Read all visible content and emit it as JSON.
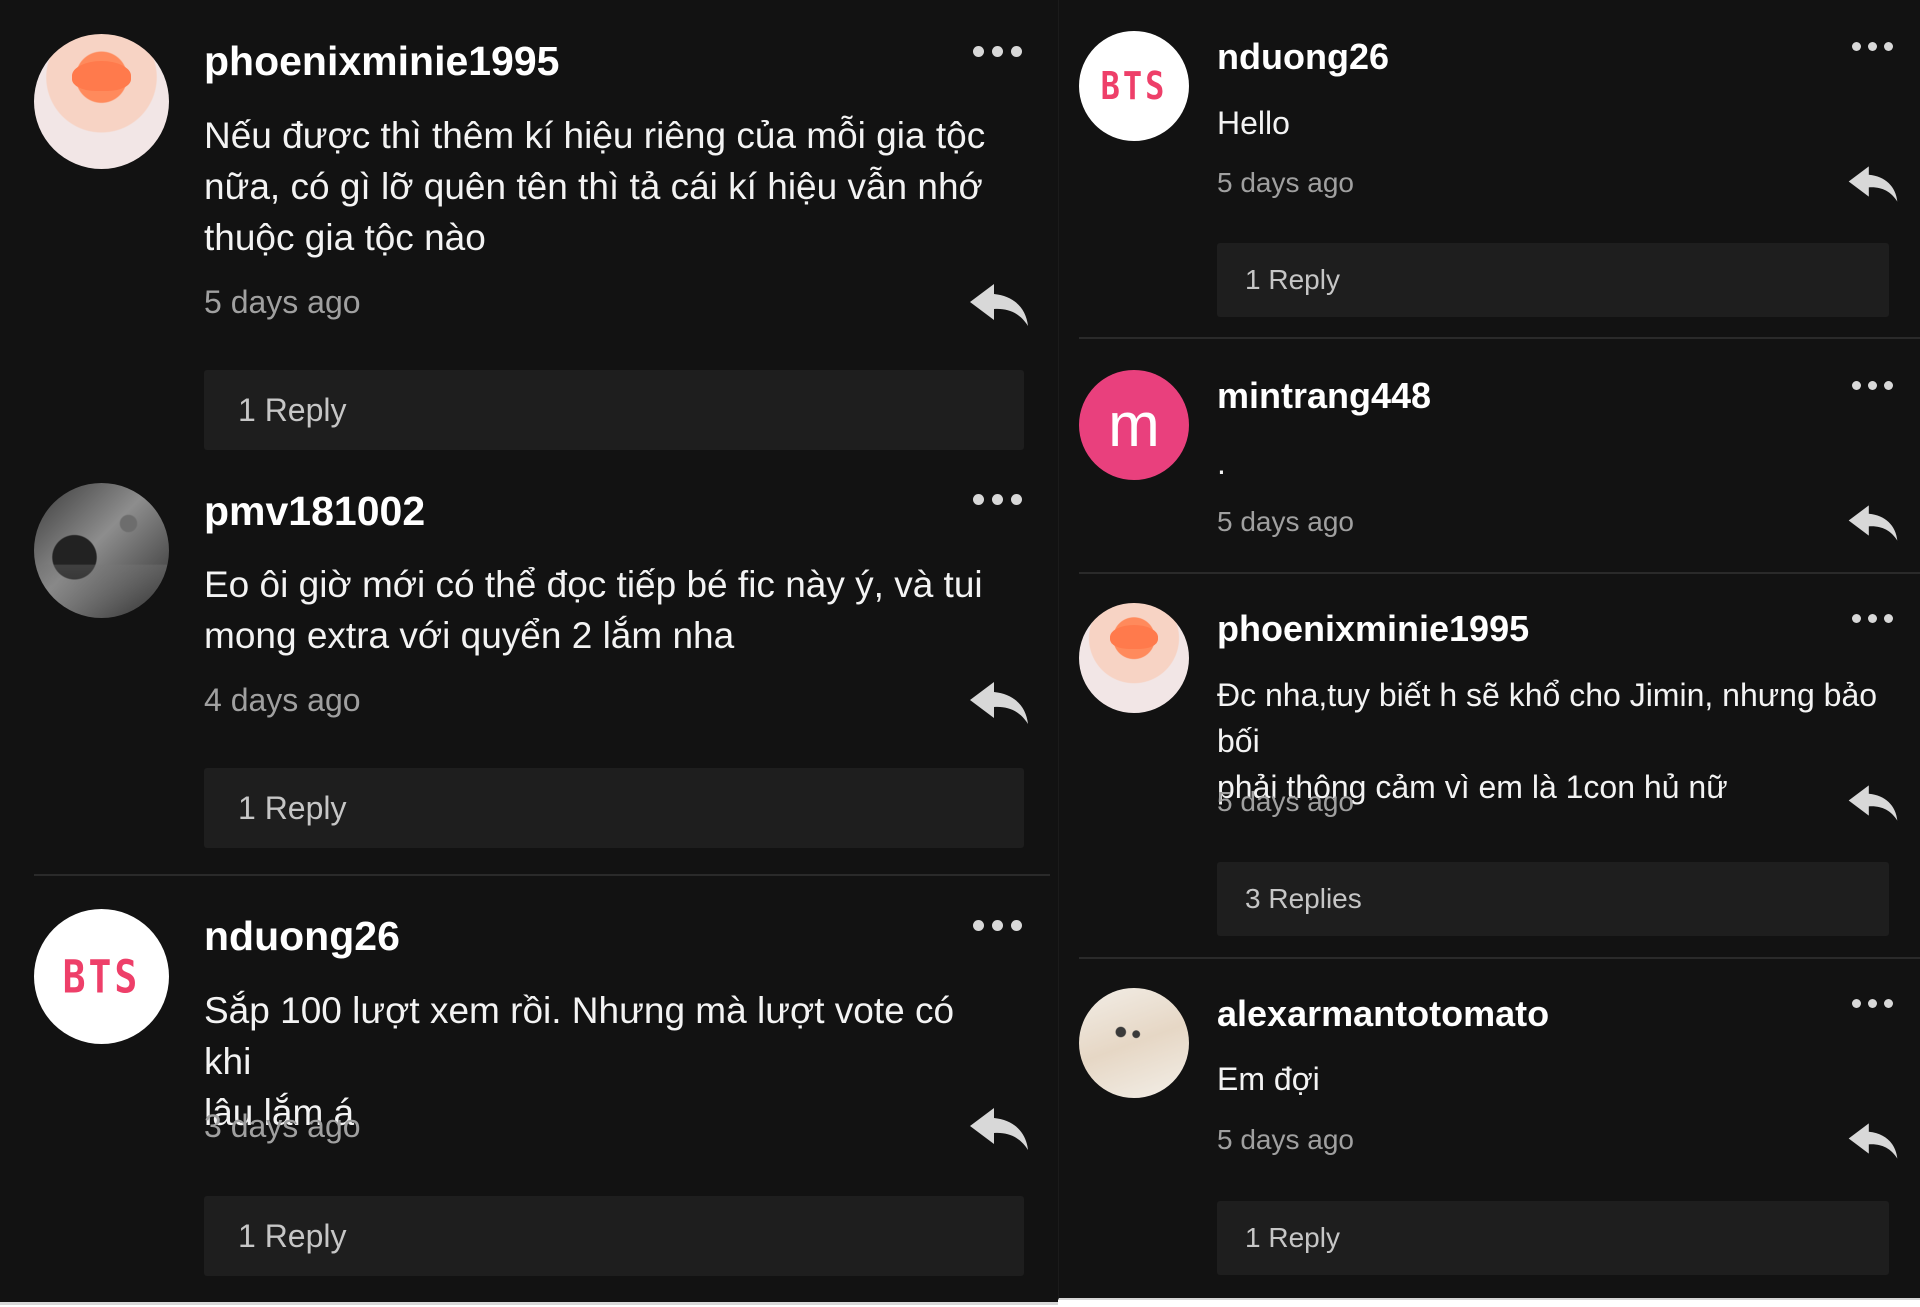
{
  "left_comments": [
    {
      "username": "phoenixminie1995",
      "text": "Nếu được thì thêm kí hiệu riêng của mỗi gia tộc\nnữa, có gì lỡ quên tên thì tả cái kí hiệu vẫn nhớ\nthuộc gia tộc nào",
      "time": "5 days ago",
      "replies": "1 Reply",
      "avatar": "photo-orange-hair"
    },
    {
      "username": "pmv181002",
      "text": "Eo ôi giờ mới có thể đọc tiếp bé fic này ý, và tui\nmong extra với quyển 2 lắm nha",
      "time": "4 days ago",
      "replies": "1 Reply",
      "avatar": "photo-dark-street"
    },
    {
      "username": "nduong26",
      "text": "Sắp 100 lượt xem rồi. Nhưng mà lượt vote có khi\nlâu lắm á",
      "time": "3 days ago",
      "replies": "1 Reply",
      "avatar": "BTS"
    }
  ],
  "right_comments": [
    {
      "username": "nduong26",
      "text": "Hello",
      "time": "5 days ago",
      "replies": "1 Reply",
      "avatar": "BTS"
    },
    {
      "username": "mintrang448",
      "text": ".",
      "time": "5 days ago",
      "avatar": "m"
    },
    {
      "username": "phoenixminie1995",
      "text": "Đc nha,tuy biết h sẽ khổ cho Jimin, nhưng bảo bối\nphải thông cảm vì em là 1con hủ nữ",
      "time": "5 days ago",
      "replies": "3 Replies",
      "avatar": "photo-orange-hair"
    },
    {
      "username": "alexarmantotomato",
      "text": "Em đợi",
      "time": "5 days ago",
      "replies": "1 Reply",
      "avatar": "photo-hands"
    }
  ],
  "icons": {
    "more": "more-horizontal-icon",
    "reply": "reply-arrow-icon"
  },
  "colors": {
    "background": "#121212",
    "reply_box": "#1e1e1e",
    "bts_pink": "#ee3f69",
    "avatar_m": "#e9407d",
    "muted_text": "#a0a0a0"
  }
}
